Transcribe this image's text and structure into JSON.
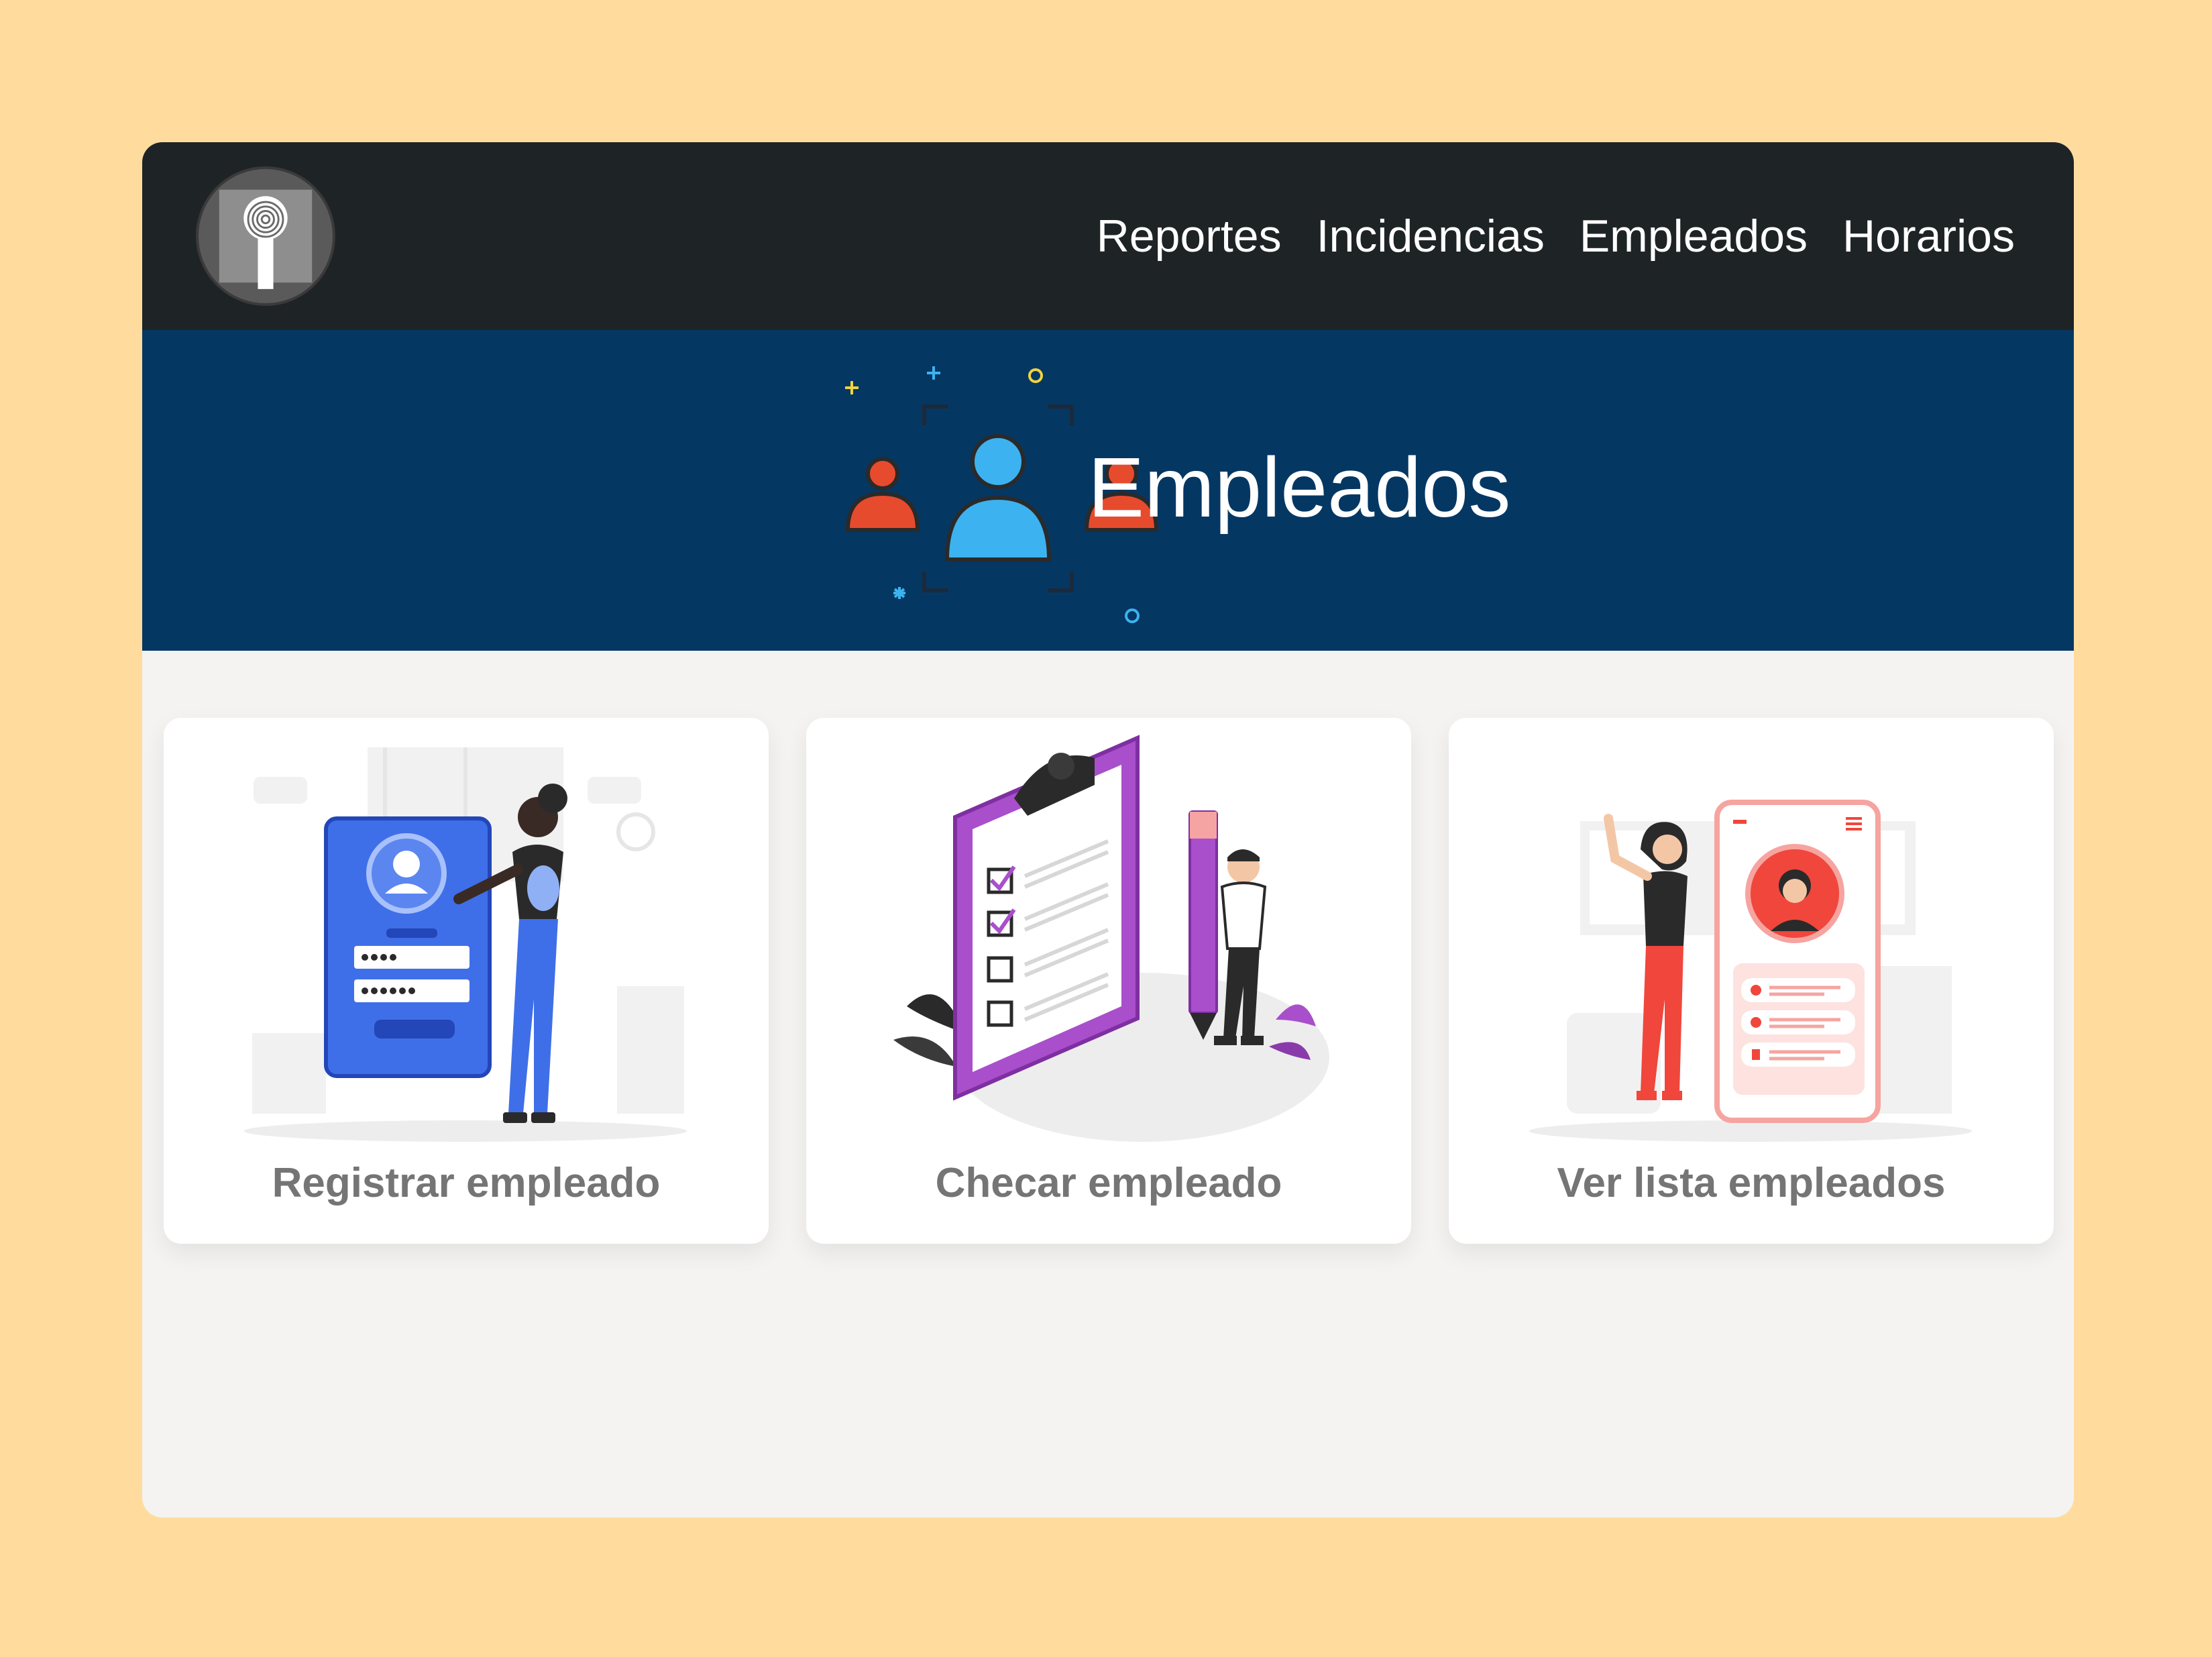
{
  "navbar": {
    "logo_icon": "fingerprint-logo-icon",
    "links": [
      "Reportes",
      "Incidencias",
      "Empleados",
      "Horarios"
    ]
  },
  "hero": {
    "icon": "employees-group-icon",
    "title": "Empleados"
  },
  "cards": [
    {
      "label": "Registrar empleado",
      "icon": "register-employee-illustration",
      "accent": "#3F6FE8"
    },
    {
      "label": "Checar empleado",
      "icon": "checklist-clipboard-illustration",
      "accent": "#A94FCB"
    },
    {
      "label": "Ver lista empleados",
      "icon": "employee-list-phone-illustration",
      "accent": "#F0463C"
    }
  ],
  "colors": {
    "page_background": "#FFDC9E",
    "navbar": "#1E2326",
    "hero": "#053763",
    "content_background": "#F4F3F1",
    "card_label": "#757575"
  }
}
